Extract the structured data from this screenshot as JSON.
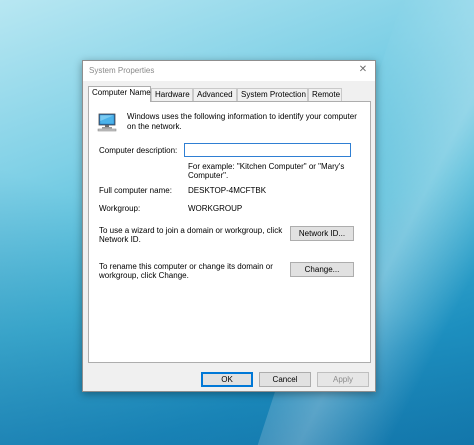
{
  "window": {
    "title": "System Properties",
    "close_glyph": "✕"
  },
  "tabs": [
    {
      "label": "Computer Name",
      "active": true
    },
    {
      "label": "Hardware",
      "active": false
    },
    {
      "label": "Advanced",
      "active": false
    },
    {
      "label": "System Protection",
      "active": false
    },
    {
      "label": "Remote",
      "active": false
    }
  ],
  "computer_name_tab": {
    "icon": "computer-icon",
    "intro_text": "Windows uses the following information to identify your computer on the network.",
    "description_label": "Computer description:",
    "description_value": "",
    "example_text": "For example: \"Kitchen Computer\" or \"Mary's Computer\".",
    "full_name_label": "Full computer name:",
    "full_name_value": "DESKTOP-4MCFTBK",
    "workgroup_label": "Workgroup:",
    "workgroup_value": "WORKGROUP",
    "network_id_text": "To use a wizard to join a domain or workgroup, click Network ID.",
    "network_id_button": "Network ID...",
    "change_text": "To rename this computer or change its domain or workgroup, click Change.",
    "change_button": "Change..."
  },
  "footer": {
    "ok_label": "OK",
    "cancel_label": "Cancel",
    "apply_label": "Apply",
    "apply_disabled": true
  },
  "colors": {
    "accent": "#0078d7",
    "desktop_light": "#b8e7f2",
    "desktop_dark": "#147aad"
  }
}
